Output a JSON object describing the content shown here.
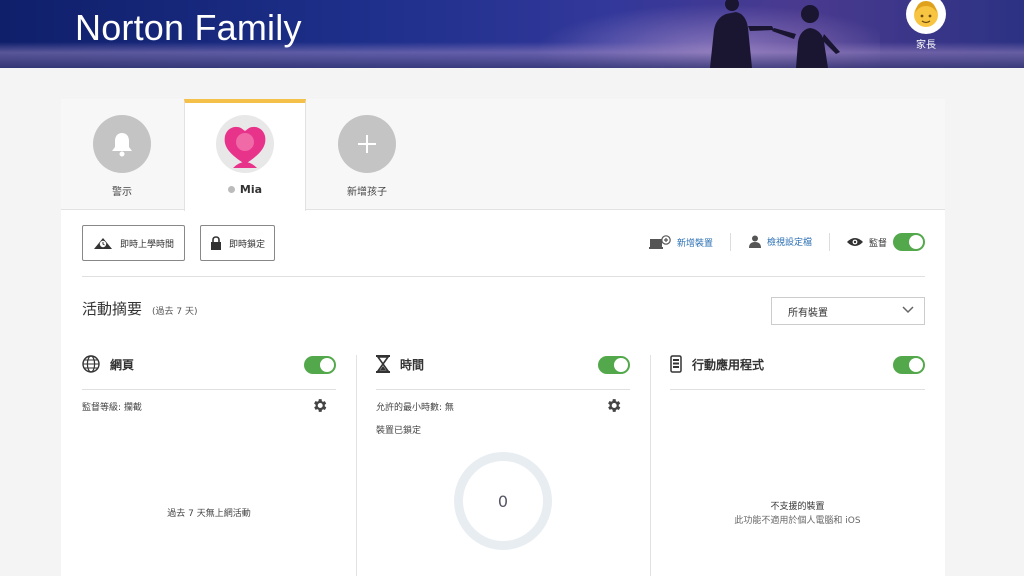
{
  "header": {
    "brand": "Norton Family",
    "parent_label": "家長"
  },
  "tabs": [
    {
      "label": "警示",
      "icon": "bell-icon"
    },
    {
      "label": "Mia",
      "icon": "child-avatar",
      "active": true
    },
    {
      "label": "新增孩子",
      "icon": "plus-icon"
    }
  ],
  "toolbar": {
    "instant_school_time": "即時上學時間",
    "instant_lock": "即時鎖定",
    "add_device": "新增裝置",
    "view_profile": "檢視設定檔",
    "supervise": "監督"
  },
  "summary": {
    "title": "活動摘要",
    "subtitle": "(過去 7 天)",
    "device_select": "所有裝置"
  },
  "panels": {
    "web": {
      "title": "網頁",
      "level": "監督等級: 攔截",
      "empty": "過去 7 天無上網活動"
    },
    "time": {
      "title": "時間",
      "allowed_hours": "允許的最小時數: 無",
      "device_locked": "裝置已鎖定",
      "usage_value": "0"
    },
    "mobile": {
      "title": "行動應用程式",
      "unsupported": "不支援的裝置",
      "unsupported_desc": "此功能不適用於個人電腦和 iOS"
    }
  },
  "colors": {
    "accent_tab": "#f4c04a",
    "toggle_on": "#52a84a",
    "link": "#2a6fb3",
    "avatar_pink": "#e8338a"
  }
}
